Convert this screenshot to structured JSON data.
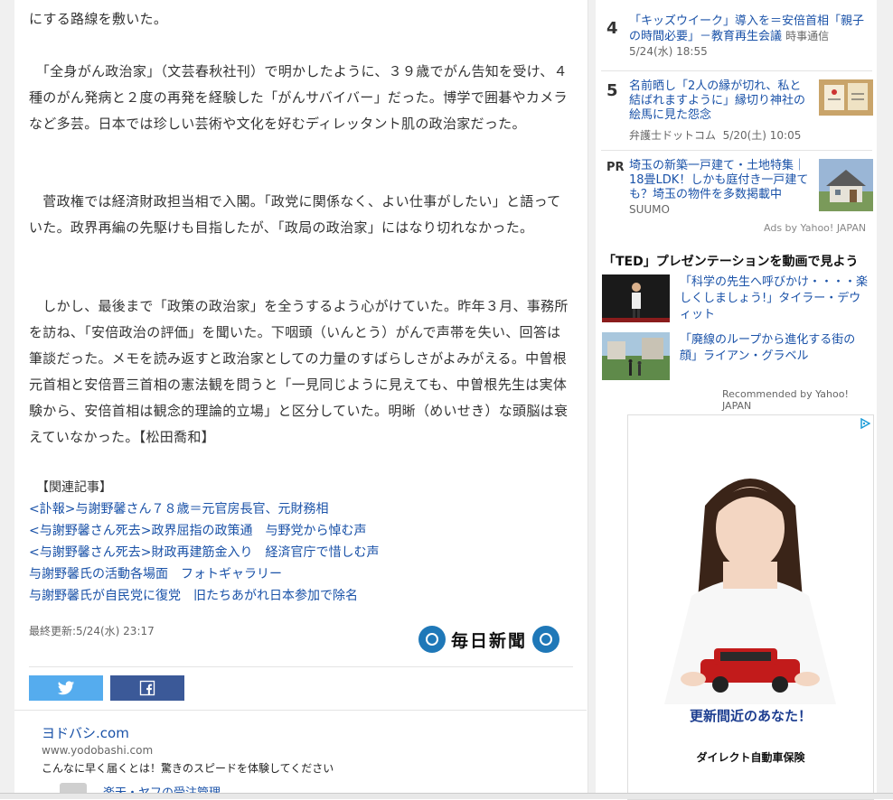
{
  "article": {
    "paragraphs": [
      "にする路線を敷いた。",
      "　「全身がん政治家」（文芸春秋社刊）で明かしたように、３９歳でがん告知を受け、４種のがん発病と２度の再発を経験した「がんサバイバー」だった。博学で囲碁やカメラなど多芸。日本では珍しい芸術や文化を好むディレッタント肌の政治家だった。",
      "　菅政権では経済財政担当相で入閣。「政党に関係なく、よい仕事がしたい」と語っていた。政界再編の先駆けも目指したが、「政局の政治家」にはなり切れなかった。",
      "　しかし、最後まで「政策の政治家」を全うするよう心がけていた。昨年３月、事務所を訪ね、「安倍政治の評価」を聞いた。下咽頭（いんとう）がんで声帯を失い、回答は筆談だった。メモを読み返すと政治家としての力量のすばらしさがよみがえる。中曽根元首相と安倍晋三首相の憲法観を問うと「一見同じように見えても、中曽根先生は実体験から、安倍首相は観念的理論的立場」と区分していた。明晰（めいせき）な頭脳は衰えていなかった。【松田喬和】"
    ],
    "related_heading": "【関連記事】",
    "related_links": [
      "<訃報>与謝野馨さん７８歳＝元官房長官、元財務相",
      "<与謝野馨さん死去>政界屈指の政策通　与野党から悼む声",
      "<与謝野馨さん死去>財政再建筋金入り　経済官庁で惜しむ声",
      "与謝野馨氏の活動各場面　フォトギャラリー",
      "与謝野馨氏が自民党に復党　旧たちあがれ日本参加で除名"
    ],
    "updated": "最終更新:5/24(水) 23:17",
    "source_logo": "毎日新聞"
  },
  "share": {
    "twitter_icon": "twitter-bird",
    "facebook_icon": "facebook-f"
  },
  "ad": {
    "title": "ヨドバシ.com",
    "url": "www.yodobashi.com",
    "desc": "こんなに早く届くとは！驚きのスピードを体験してください",
    "next_text": "楽天・ヤフの受注管理"
  },
  "sidebar": {
    "ranking": [
      {
        "num": "4",
        "title": "「キッズウイーク」導入を＝安倍首相「親子の時間必要」－教育再生会議",
        "source": "時事通信",
        "time": "5/24(水) 18:55"
      },
      {
        "num": "5",
        "title": "名前晒し「2人の縁が切れ、私と結ばれますように」縁切り神社の絵馬に見た怨念",
        "source": "弁護士ドットコム",
        "time": "5/20(土) 10:05"
      },
      {
        "num": "PR",
        "title": "埼玉の新築一戸建て・土地特集｜18畳LDK！しかも庭付き一戸建ても？埼玉の物件を多数掲載中",
        "source": "SUUMO",
        "time": ""
      }
    ],
    "ads_by": "Ads by Yahoo! JAPAN",
    "ted_title": "「TED」プレゼンテーションを動画で見よう",
    "ted_items": [
      "「科学の先生へ呼びかけ・・・・楽しくしましょう!」タイラー・デウィット",
      "「廃線のループから進化する街の顔」ライアン・グラベル"
    ],
    "recommended_by": "Recommended by Yahoo! JAPAN",
    "banner": {
      "headline": "更新間近のあなた！",
      "company": "ダイレクト自動車保険"
    }
  },
  "colors": {
    "link": "#1a52a8",
    "twitter": "#55acee",
    "facebook": "#3b5998",
    "mainichi_blue": "#1f78b8"
  }
}
